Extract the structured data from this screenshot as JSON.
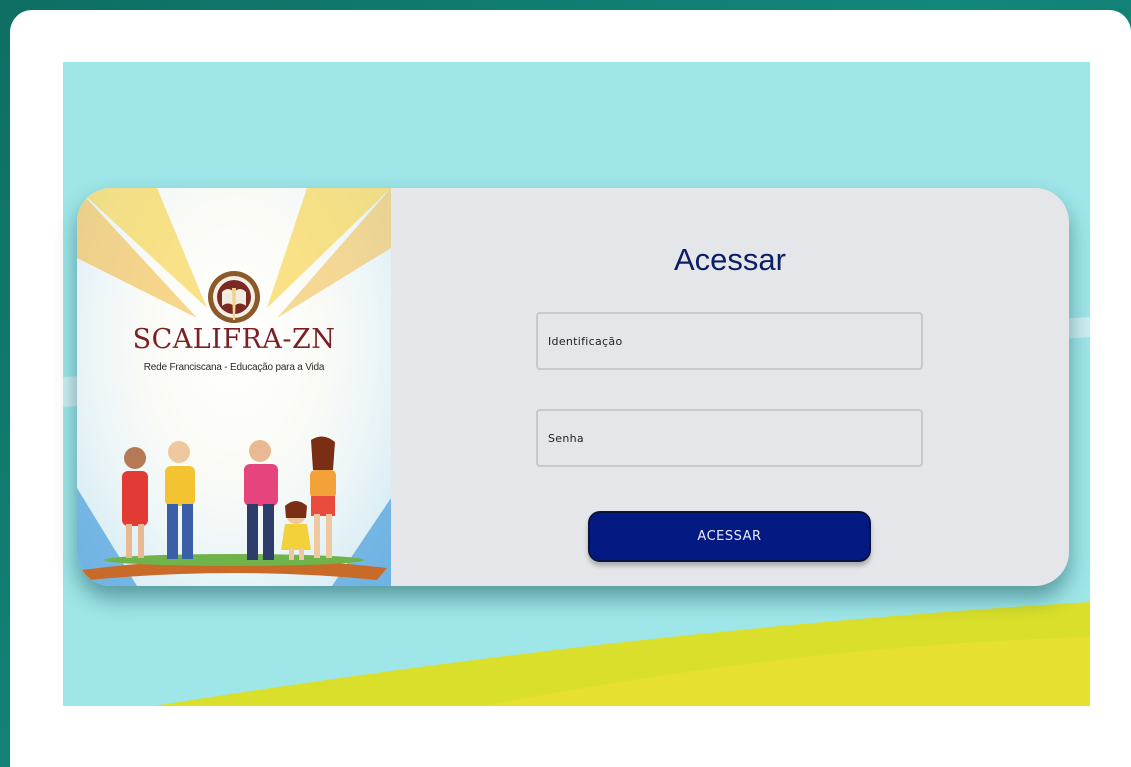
{
  "brand": {
    "name": "SCALIFRA-ZN",
    "tagline": "Rede Franciscana - Educação para a Vida"
  },
  "login": {
    "title": "Acessar",
    "id_placeholder": "Identificação",
    "password_placeholder": "Senha",
    "submit_label": "ACESSAR"
  },
  "colors": {
    "accent": "#041a82",
    "title": "#0c1f63",
    "brand": "#7a1f24",
    "stage_background": "#9ee6e8",
    "wave": "#e1dc2a"
  }
}
